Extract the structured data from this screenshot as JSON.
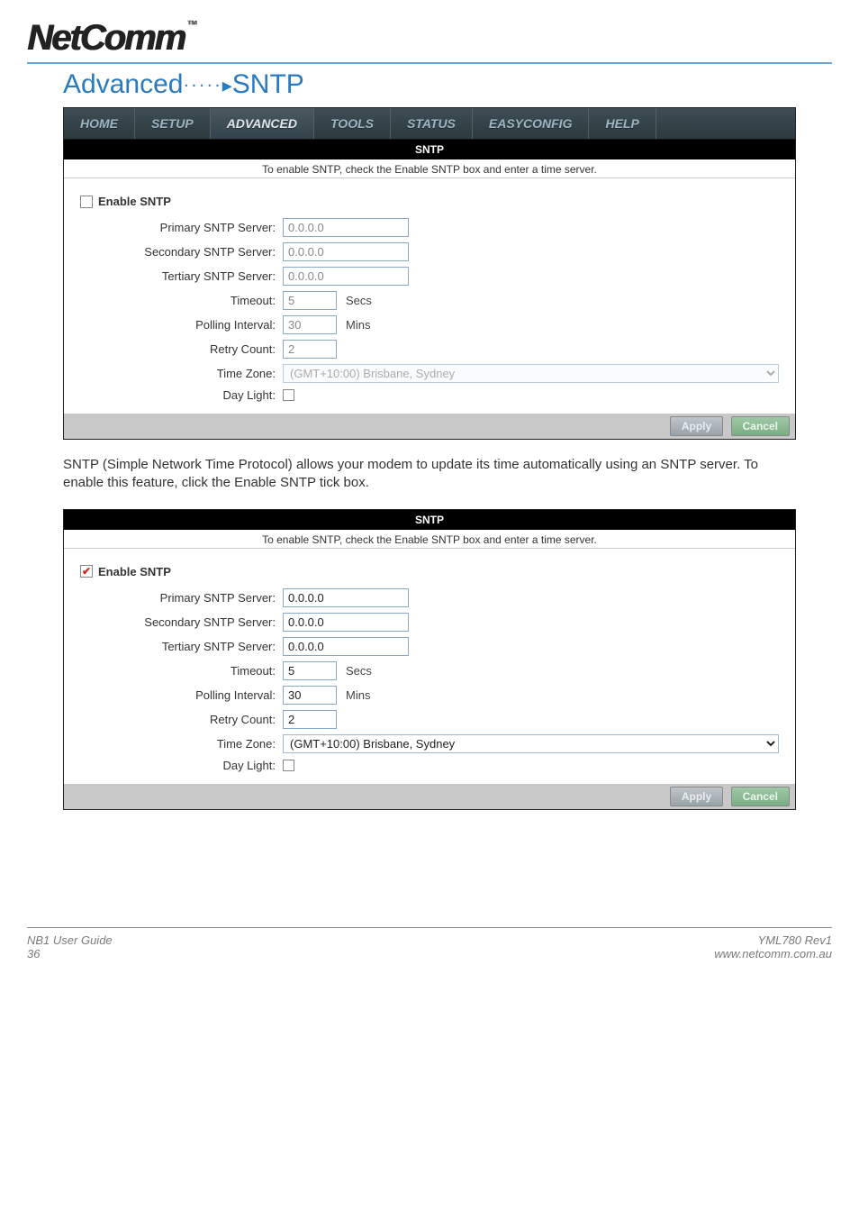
{
  "logo": {
    "text": "NetComm",
    "tm": "™"
  },
  "heading": {
    "prefix": "Advanced",
    "suffix": "SNTP"
  },
  "nav": {
    "home": "HOME",
    "setup": "SETUP",
    "advanced": "ADVANCED",
    "tools": "TOOLS",
    "status": "STATUS",
    "easyconfig": "EASYCONFIG",
    "help": "HELP"
  },
  "sntp": {
    "title": "SNTP",
    "hint": "To enable SNTP, check the Enable SNTP box and enter a time server.",
    "enable_label": "Enable SNTP",
    "primary_label": "Primary SNTP Server:",
    "secondary_label": "Secondary SNTP Server:",
    "tertiary_label": "Tertiary SNTP Server:",
    "timeout_label": "Timeout:",
    "polling_label": "Polling Interval:",
    "retry_label": "Retry Count:",
    "tz_label": "Time Zone:",
    "daylight_label": "Day Light:",
    "secs": "Secs",
    "mins": "Mins",
    "apply": "Apply",
    "cancel": "Cancel"
  },
  "disabled_form": {
    "primary": "0.0.0.0",
    "secondary": "0.0.0.0",
    "tertiary": "0.0.0.0",
    "timeout": "5",
    "polling": "30",
    "retry": "2",
    "tz": "(GMT+10:00) Brisbane, Sydney"
  },
  "enabled_form": {
    "primary": "0.0.0.0",
    "secondary": "0.0.0.0",
    "tertiary": "0.0.0.0",
    "timeout": "5",
    "polling": "30",
    "retry": "2",
    "tz": "(GMT+10:00) Brisbane, Sydney"
  },
  "body_text": "SNTP (Simple Network Time Protocol) allows your modem to update its time automatically using an SNTP server. To enable this feature, click the Enable SNTP tick box.",
  "footer": {
    "left_line1": "NB1 User Guide",
    "left_line2": "36",
    "right_line1": "YML780 Rev1",
    "right_line2": "www.netcomm.com.au"
  }
}
